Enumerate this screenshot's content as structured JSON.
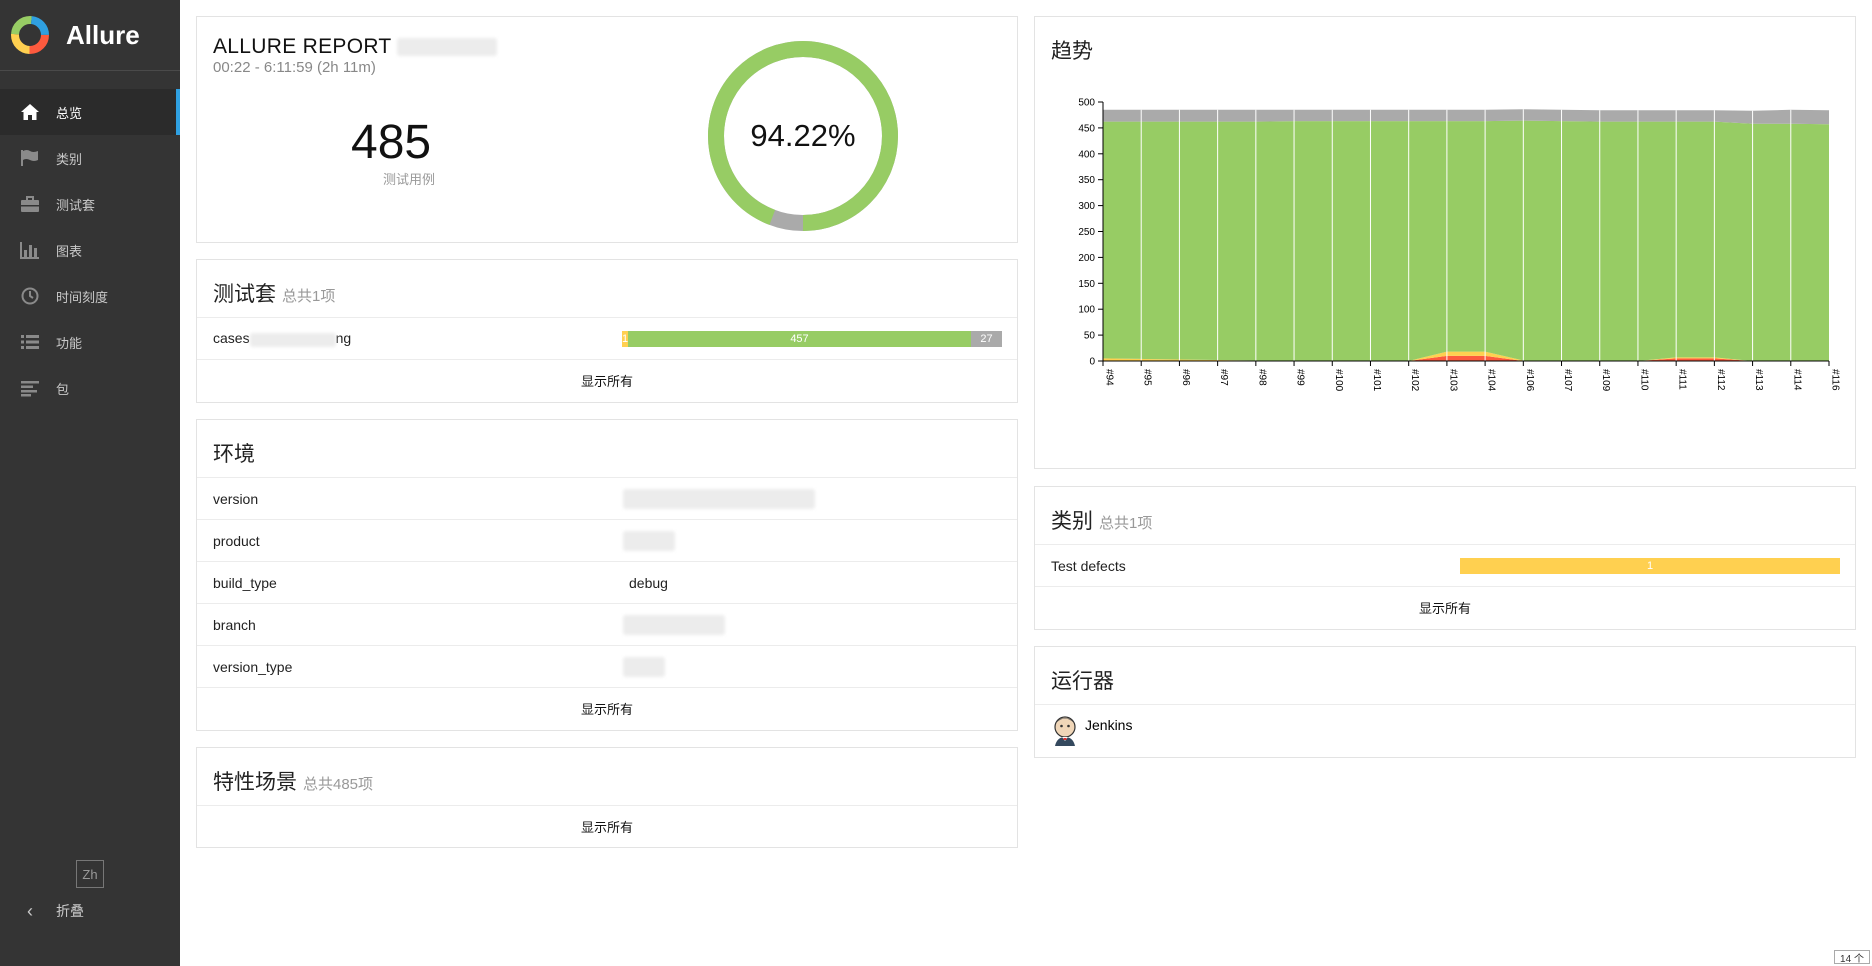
{
  "app": {
    "name": "Allure"
  },
  "sidebar": {
    "items": [
      {
        "label": "总览",
        "icon": "home-icon",
        "active": true
      },
      {
        "label": "类别",
        "icon": "flag-icon",
        "active": false
      },
      {
        "label": "测试套",
        "icon": "briefcase-icon",
        "active": false
      },
      {
        "label": "图表",
        "icon": "bar-chart-icon",
        "active": false
      },
      {
        "label": "时间刻度",
        "icon": "clock-icon",
        "active": false
      },
      {
        "label": "功能",
        "icon": "list-icon",
        "active": false
      },
      {
        "label": "包",
        "icon": "align-left-icon",
        "active": false
      }
    ],
    "language": "Zh",
    "collapse_label": "折叠"
  },
  "summary": {
    "title": "ALLURE REPORT",
    "time_range": "00:22 - 6:11:59 (2h 11m)",
    "test_count": "485",
    "test_count_label": "测试用例",
    "pass_rate": "94.22%",
    "pass_fraction": 0.9422
  },
  "suites": {
    "title": "测试套",
    "subtitle": "总共1项",
    "items": [
      {
        "name_start": "cases",
        "name_end": "ng",
        "broken": 1,
        "passed": 457,
        "skipped": 27
      }
    ],
    "show_all": "显示所有"
  },
  "environment": {
    "title": "环境",
    "rows": [
      {
        "key": "version",
        "value": ""
      },
      {
        "key": "product",
        "value": ""
      },
      {
        "key": "build_type",
        "value": "debug"
      },
      {
        "key": "branch",
        "value": ""
      },
      {
        "key": "version_type",
        "value": ""
      }
    ],
    "show_all": "显示所有"
  },
  "features": {
    "title": "特性场景",
    "subtitle": "总共485项",
    "show_all": "显示所有"
  },
  "trend": {
    "title": "趋势"
  },
  "categories": {
    "title": "类别",
    "subtitle": "总共1项",
    "items": [
      {
        "name": "Test defects",
        "count": "1"
      }
    ],
    "show_all": "显示所有"
  },
  "executors": {
    "title": "运行器",
    "items": [
      {
        "name": "Jenkins"
      }
    ]
  },
  "footer": {
    "count_label": "14 个"
  },
  "colors": {
    "passed": "#97cc64",
    "failed": "#fd5a3e",
    "broken": "#ffd050",
    "skipped": "#aaaaaa",
    "sidebar_bg": "#343434",
    "accent": "#2fa0e1"
  },
  "chart_data": {
    "type": "area",
    "title": "趋势",
    "x": [
      "#94",
      "#95",
      "#96",
      "#97",
      "#98",
      "#99",
      "#100",
      "#101",
      "#102",
      "#103",
      "#104",
      "#106",
      "#107",
      "#109",
      "#110",
      "#111",
      "#112",
      "#113",
      "#114",
      "#116"
    ],
    "ylim": [
      0,
      500
    ],
    "yticks": [
      0,
      50,
      100,
      150,
      200,
      250,
      300,
      350,
      400,
      450,
      500
    ],
    "series": [
      {
        "name": "failed",
        "values": [
          0,
          0,
          0,
          0,
          0,
          0,
          0,
          0,
          0,
          10,
          10,
          0,
          0,
          0,
          0,
          5,
          5,
          0,
          0,
          0
        ]
      },
      {
        "name": "broken",
        "values": [
          5,
          4,
          3,
          2,
          1,
          0,
          0,
          0,
          0,
          8,
          8,
          1,
          0,
          0,
          0,
          2,
          2,
          0,
          0,
          0
        ]
      },
      {
        "name": "passed",
        "values": [
          457,
          458,
          459,
          460,
          461,
          463,
          463,
          463,
          463,
          445,
          445,
          463,
          463,
          462,
          462,
          455,
          455,
          458,
          458,
          457
        ]
      },
      {
        "name": "skipped",
        "values": [
          23,
          23,
          23,
          23,
          23,
          22,
          22,
          22,
          22,
          22,
          22,
          22,
          22,
          22,
          22,
          22,
          22,
          25,
          27,
          27
        ]
      }
    ],
    "grid": true
  }
}
